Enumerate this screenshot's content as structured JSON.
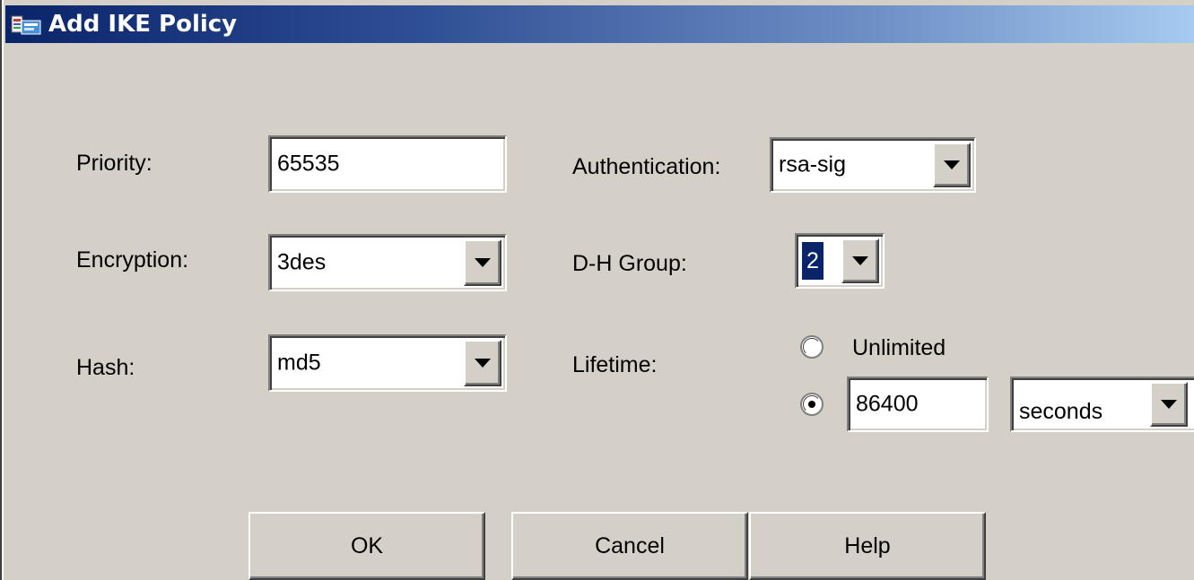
{
  "window": {
    "title": "Add IKE Policy",
    "icon": "asdm-app-icon"
  },
  "form": {
    "priority": {
      "label": "Priority:",
      "value": "65535"
    },
    "encryption": {
      "label": "Encryption:",
      "value": "3des"
    },
    "hash": {
      "label": "Hash:",
      "value": "md5"
    },
    "authentication": {
      "label": "Authentication:",
      "value": "rsa-sig"
    },
    "dh_group": {
      "label": "D-H Group:",
      "value": "2"
    },
    "lifetime": {
      "label": "Lifetime:",
      "unlimited_label": "Unlimited",
      "unlimited_selected": false,
      "value_selected": true,
      "value": "86400",
      "unit": "seconds"
    }
  },
  "buttons": {
    "ok": "OK",
    "cancel": "Cancel",
    "help": "Help"
  },
  "colors": {
    "title_start": "#0a246a",
    "title_end": "#a6caf0",
    "face": "#d4d0c8",
    "selection": "#0a246a"
  }
}
